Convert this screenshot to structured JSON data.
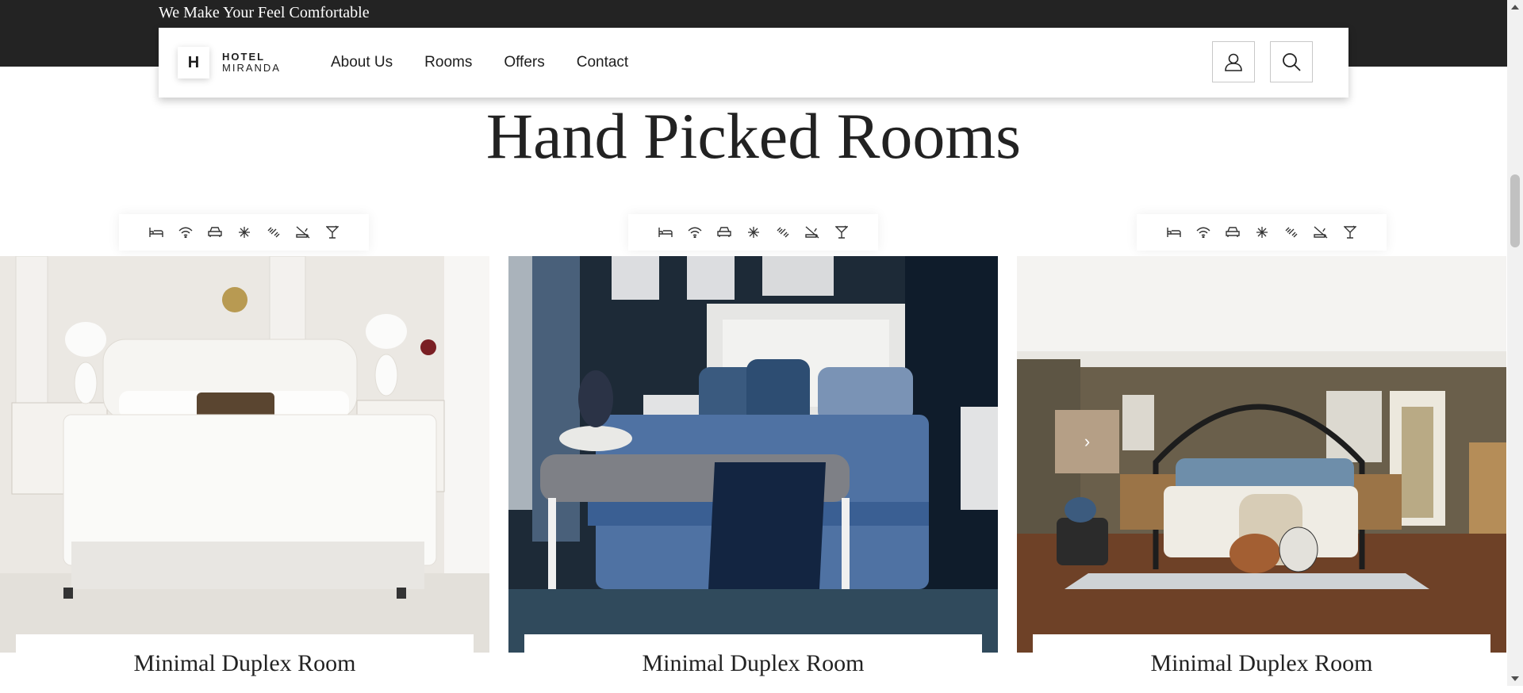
{
  "topbar": {
    "tagline": "We Make Your Feel Comfortable"
  },
  "header": {
    "logo_letter": "H",
    "logo_line1": "HOTEL",
    "logo_line2": "MIRANDA",
    "nav": [
      "About Us",
      "Rooms",
      "Offers",
      "Contact"
    ],
    "user_icon": "user-icon",
    "search_icon": "search-icon"
  },
  "section": {
    "title": "Hand Picked Rooms"
  },
  "amenity_icons": [
    "bed-icon",
    "wifi-icon",
    "car-icon",
    "snowflake-icon",
    "dumbbell-icon",
    "no-smoking-icon",
    "cocktail-icon"
  ],
  "rooms": [
    {
      "name": "Minimal Duplex Room",
      "image": "white bedroom"
    },
    {
      "name": "Minimal Duplex Room",
      "image": "navy bedroom"
    },
    {
      "name": "Minimal Duplex Room",
      "image": "canopy bedroom"
    }
  ],
  "slider": {
    "prev_glyph": "›"
  },
  "colors": {
    "topband": "#232323",
    "accent": "#b59f86",
    "text": "#1e1e1e"
  }
}
